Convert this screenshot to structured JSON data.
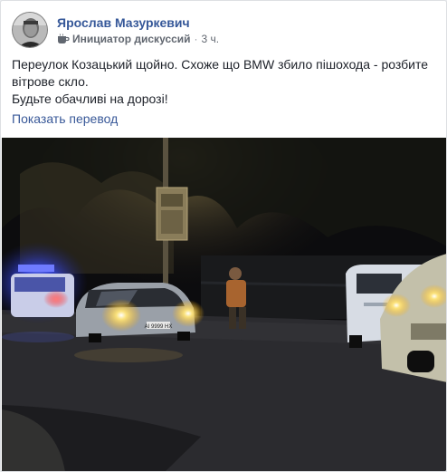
{
  "post": {
    "author": "Ярослав Мазуркевич",
    "badge": "Инициатор дискуссий",
    "badge_icon": "coffee-cup-icon",
    "separator": "·",
    "time": "3 ч.",
    "text_line1": "Переулок Козацький щойно. Схоже що BMW збило пішохода - розбите",
    "text_line2": "вітрове скло.",
    "text_line3": "Будьте обачливі на дорозі!",
    "translate_link": "Показать перевод"
  },
  "photo": {
    "car_plate": "AI 9999 HX"
  },
  "colors": {
    "link": "#365899",
    "text": "#1d2129",
    "meta": "#616770",
    "police_blue": "#3b4dff",
    "headlight": "#ffd966"
  }
}
